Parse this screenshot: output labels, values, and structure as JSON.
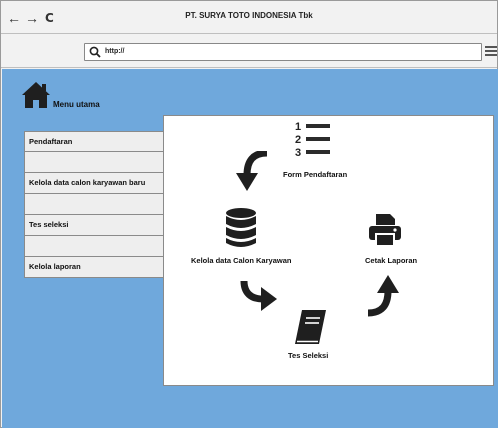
{
  "window": {
    "title": "PT. SURYA TOTO INDONESIA Tbk"
  },
  "navbar": {
    "back": "←",
    "forward": "→",
    "reload": "C",
    "url": "http://"
  },
  "home": {
    "label": "Menu utama"
  },
  "sidebar": {
    "items": [
      {
        "label": "Pendaftaran"
      },
      {
        "label": ""
      },
      {
        "label": "Kelola data calon karyawan baru"
      },
      {
        "label": ""
      },
      {
        "label": "Tes seleksi"
      },
      {
        "label": ""
      },
      {
        "label": "Kelola laporan"
      }
    ]
  },
  "flow": {
    "form": {
      "label": "Form Pendaftaran",
      "icon": "numbered-list-icon"
    },
    "kelola": {
      "label": "Kelola data Calon Karyawan",
      "icon": "database-icon"
    },
    "tes": {
      "label": "Tes Seleksi",
      "icon": "book-icon"
    },
    "cetak": {
      "label": "Cetak Laporan",
      "icon": "printer-icon"
    },
    "list_numbers": [
      "1",
      "2",
      "3"
    ]
  },
  "colors": {
    "background": "#6fa8dc",
    "panel": "#ffffff",
    "icon": "#2b2b2b"
  }
}
